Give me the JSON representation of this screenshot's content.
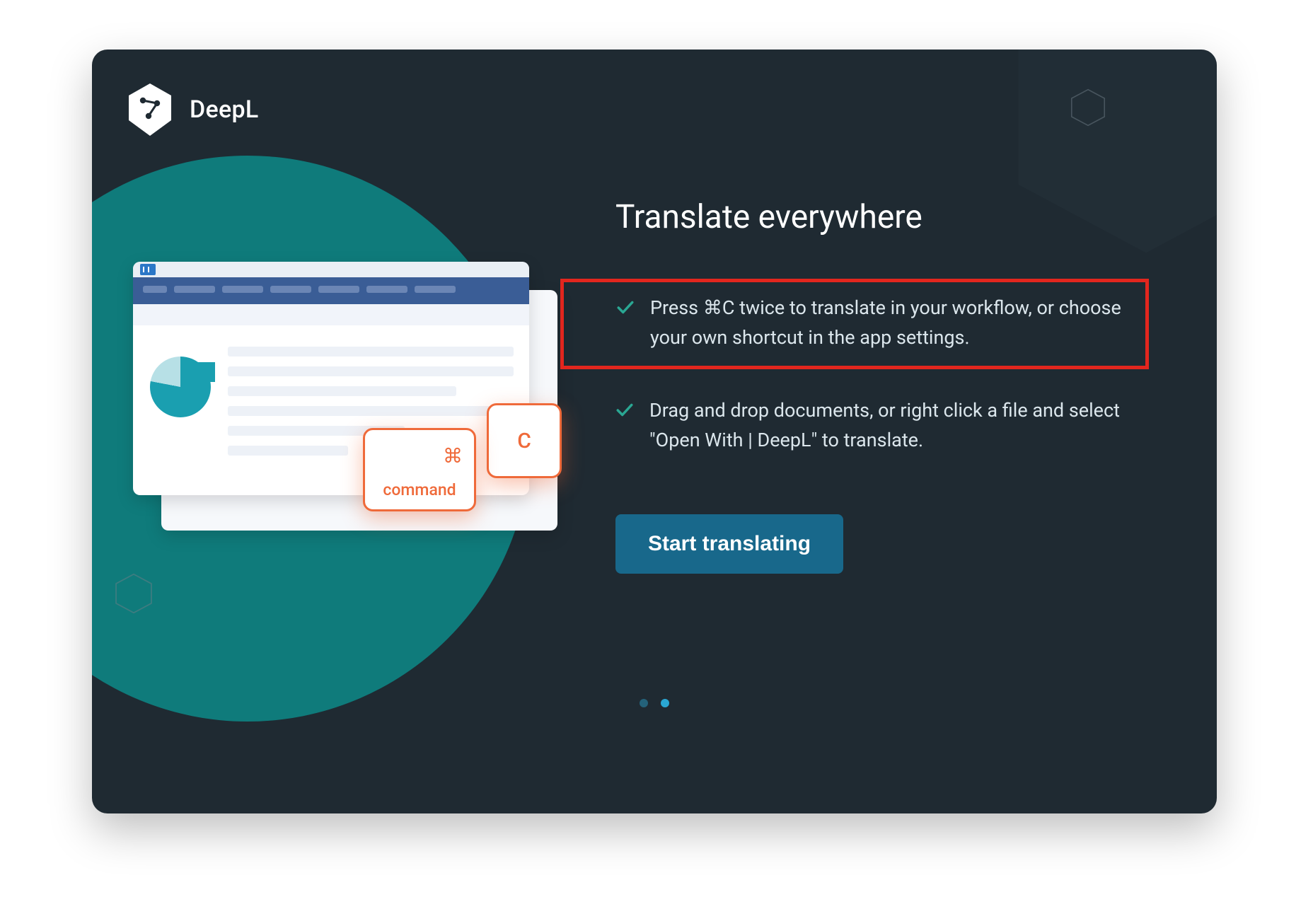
{
  "brand": "DeepL",
  "headline": "Translate everywhere",
  "tips": [
    "Press ⌘C twice to translate in your workflow, or choose your own shortcut in the app settings.",
    "Drag and drop documents, or right click a file and select \"Open With | DeepL\" to translate."
  ],
  "cta_label": "Start translating",
  "highlighted_tip_index": 0,
  "illustration": {
    "key_command_label": "command",
    "key_cmd_symbol": "⌘",
    "key_c_label": "C"
  },
  "pager": {
    "count": 2,
    "active_index": 1
  },
  "colors": {
    "background": "#1f2a32",
    "teal": "#0f7b7b",
    "accent_orange": "#ef6a3a",
    "cta": "#18688b",
    "highlight": "#e2261e",
    "check": "#2aa793"
  }
}
